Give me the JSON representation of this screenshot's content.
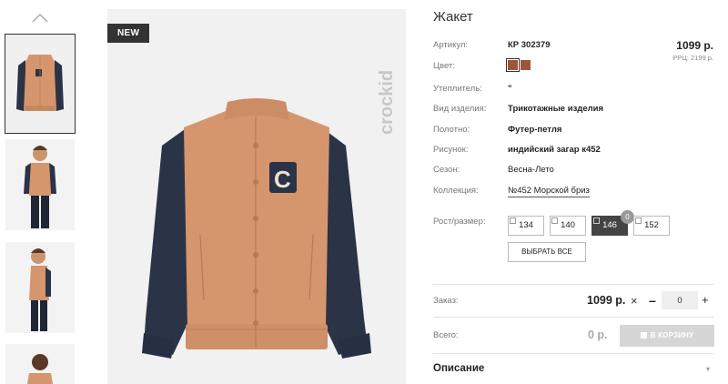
{
  "product": {
    "title": "Жакет",
    "badge": "NEW",
    "brand": "crockid"
  },
  "attributes": [
    {
      "key": "Артикул:",
      "value": "КР 302379",
      "style": "bold"
    },
    {
      "key": "Цвет:",
      "value": "",
      "style": "swatch"
    },
    {
      "key": "Утеплитель:",
      "value": "\"",
      "style": "bold"
    },
    {
      "key": "Вид изделия:",
      "value": "Трикотажные изделия",
      "style": "bold"
    },
    {
      "key": "Полотно:",
      "value": "Футер-петля",
      "style": "bold"
    },
    {
      "key": "Рисунок:",
      "value": "индийский загар к452",
      "style": "bold"
    },
    {
      "key": "Сезон:",
      "value": "Весна-Лето",
      "style": "normal"
    },
    {
      "key": "Коллекция:",
      "value": "№452 Морской бриз",
      "style": "link"
    }
  ],
  "colors": {
    "swatch": "#a0553a",
    "selected_size_bg": "#444444",
    "cart_button_bg": "#d6d6d6"
  },
  "price": {
    "value": "1099 р.",
    "rrc": "РРЦ: 2199 р."
  },
  "sizes": {
    "label": "Рост/размер:",
    "options": [
      "134",
      "140",
      "146",
      "152"
    ],
    "selected": "146",
    "stock_badge": "0",
    "select_all_label": "ВЫБРАТЬ ВСЕ"
  },
  "order": {
    "label": "Заказ:",
    "price": "1099 р.",
    "times": "×",
    "minus": "–",
    "quantity": "0",
    "plus": "+"
  },
  "total": {
    "label": "Всего:",
    "value": "0 р.",
    "cart_button_label": "В КОРЗИНУ"
  },
  "description": {
    "label": "Описание",
    "caret": "▾"
  },
  "icons": {
    "thumbs_up": "chevron-up-icon",
    "cart": "cart-icon",
    "collapse": "chevron-down-icon"
  }
}
